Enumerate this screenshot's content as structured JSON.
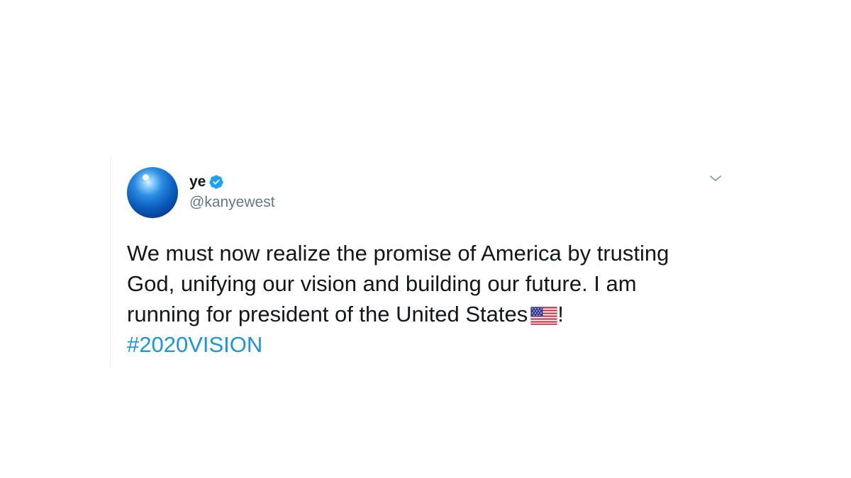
{
  "tweet": {
    "display_name": "ye",
    "handle": "@kanyewest",
    "verified": true,
    "text_lines": [
      "We must now realize the promise of America by trusting",
      "God, unifying our vision and building our future. I am",
      "running for president of the United States",
      "!"
    ],
    "hashtag": "#2020VISION",
    "icons": {
      "avatar": "blue-sphere-avatar",
      "verified": "verified-badge-icon",
      "menu": "chevron-down-icon",
      "flag": "us-flag-emoji"
    }
  },
  "colors": {
    "text": "#14171a",
    "handle": "#657786",
    "link": "#1b95e0",
    "verified": "#1da1f2"
  }
}
